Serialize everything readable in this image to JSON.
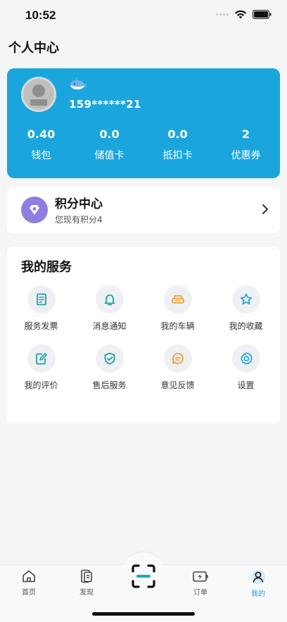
{
  "status_bar": {
    "time": "10:52"
  },
  "page": {
    "title": "个人中心"
  },
  "profile": {
    "phone": "159******21",
    "stats": [
      {
        "value": "0.40",
        "label": "钱包"
      },
      {
        "value": "0.0",
        "label": "储值卡"
      },
      {
        "value": "0.0",
        "label": "抵扣卡"
      },
      {
        "value": "2",
        "label": "优惠券"
      }
    ]
  },
  "points": {
    "title": "积分中心",
    "subtitle": "您现有积分4"
  },
  "services": {
    "title": "我的服务",
    "items": [
      {
        "label": "服务发票",
        "icon": "invoice-icon"
      },
      {
        "label": "消息通知",
        "icon": "bell-icon"
      },
      {
        "label": "我的车辆",
        "icon": "car-icon"
      },
      {
        "label": "我的收藏",
        "icon": "star-icon"
      },
      {
        "label": "我的评价",
        "icon": "edit-icon"
      },
      {
        "label": "售后服务",
        "icon": "shield-check-icon"
      },
      {
        "label": "意见反馈",
        "icon": "chat-bubble-icon"
      },
      {
        "label": "设置",
        "icon": "gear-icon"
      }
    ]
  },
  "tabs": [
    {
      "label": "首页",
      "icon": "home-icon"
    },
    {
      "label": "发现",
      "icon": "discover-icon"
    },
    {
      "label": "",
      "icon": "scan-icon"
    },
    {
      "label": "订单",
      "icon": "order-icon"
    },
    {
      "label": "我的",
      "icon": "user-icon",
      "active": true
    }
  ],
  "colors": {
    "primary": "#1aa6dc",
    "points_badge": "#8f7ee0",
    "service_teal": "#1ba39c",
    "service_orange": "#f0a030",
    "service_blue": "#1aa6dc"
  }
}
